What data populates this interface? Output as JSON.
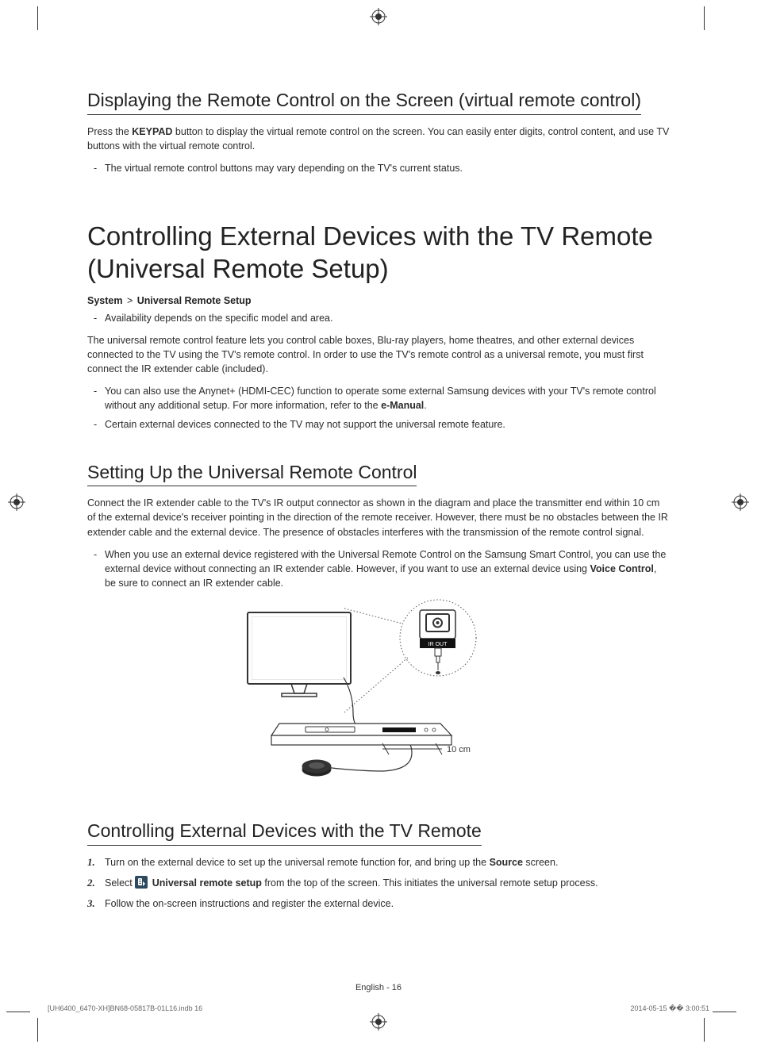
{
  "section1": {
    "heading": "Displaying the Remote Control on the Screen (virtual remote control)",
    "para1_a": "Press the ",
    "para1_b": "KEYPAD",
    "para1_c": " button to display the virtual remote control on the screen. You can easily enter digits, control content, and use TV buttons with the virtual remote control.",
    "bullets": [
      "The virtual remote control buttons may vary depending on the TV's current status."
    ]
  },
  "section2": {
    "heading": "Controlling External Devices with the TV Remote (Universal Remote Setup)",
    "breadcrumb_a": "System",
    "breadcrumb_sep": ">",
    "breadcrumb_b": "Universal Remote Setup",
    "bullets1": [
      "Availability depends on the specific model and area."
    ],
    "para": "The universal remote control feature lets you control cable boxes, Blu-ray players, home theatres, and other external devices connected to the TV using the TV's remote control. In order to use the TV's remote control as a universal remote, you must first connect the IR extender cable (included).",
    "bullets2_a": "You can also use the Anynet+ (HDMI-CEC) function to operate some external Samsung devices with your TV's remote control without any additional setup. For more information, refer to the ",
    "bullets2_b": "e-Manual",
    "bullets2_c": ".",
    "bullets2_2": "Certain external devices connected to the TV may not support the universal remote feature."
  },
  "section3": {
    "heading": "Setting Up the Universal Remote Control",
    "para": "Connect the IR extender cable to the TV's IR output connector as shown in the diagram and place the transmitter end within 10 cm of the external device's receiver pointing in the direction of the remote receiver. However, there must be no obstacles between the IR extender cable and the external device. The presence of obstacles interferes with the transmission of the remote control signal.",
    "bullets_a": "When you use an external device registered with the Universal Remote Control on the Samsung Smart Control, you can use the external device without connecting an IR extender cable. However, if you want to use an external device using ",
    "bullets_b": "Voice Control",
    "bullets_c": ", be sure to connect an IR extender cable.",
    "diagram": {
      "ir_out_label": "IR OUT",
      "distance_label": "10 cm"
    }
  },
  "section4": {
    "heading": "Controlling External Devices with the TV Remote",
    "steps": {
      "s1_a": "Turn on the external device to set up the universal remote function for, and bring up the ",
      "s1_b": "Source",
      "s1_c": " screen.",
      "s2_a": "Select ",
      "s2_b": "Universal remote setup",
      "s2_c": " from the top of the screen. This initiates the universal remote setup process.",
      "s3": "Follow the on-screen instructions and register the external device."
    }
  },
  "footer": {
    "page_label": "English - 16"
  },
  "print_footer": {
    "left": "[UH6400_6470-XH]BN68-05817B-01L16.indb   16",
    "right": "2014-05-15   �� 3:00:51"
  }
}
